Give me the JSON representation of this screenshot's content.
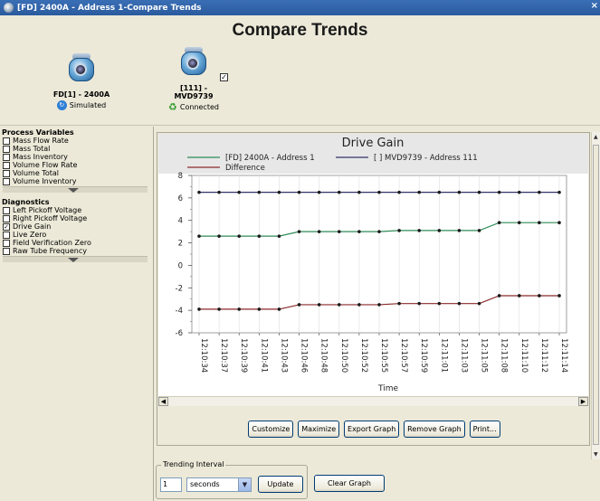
{
  "window": {
    "title": "[FD] 2400A - Address 1-Compare Trends",
    "close_glyph": "×"
  },
  "page": {
    "title": "Compare Trends"
  },
  "devices": [
    {
      "name": "FD[1] - 2400A",
      "status": "Simulated"
    },
    {
      "name_line1": "[111] -",
      "name_line2": "MVD9739",
      "status": "Connected",
      "checked": true
    }
  ],
  "sidebar": {
    "process_variables": {
      "title": "Process Variables",
      "items": [
        {
          "label": "Mass Flow Rate",
          "checked": false
        },
        {
          "label": "Mass Total",
          "checked": false
        },
        {
          "label": "Mass Inventory",
          "checked": false
        },
        {
          "label": "Volume Flow Rate",
          "checked": false
        },
        {
          "label": "Volume Total",
          "checked": false
        },
        {
          "label": "Volume Inventory",
          "checked": false
        }
      ]
    },
    "diagnostics": {
      "title": "Diagnostics",
      "items": [
        {
          "label": "Left Pickoff Voltage",
          "checked": false
        },
        {
          "label": "Right Pickoff Voltage",
          "checked": false
        },
        {
          "label": "Drive Gain",
          "checked": true
        },
        {
          "label": "Live Zero",
          "checked": false
        },
        {
          "label": "Field Verification Zero",
          "checked": false
        },
        {
          "label": "Raw Tube Frequency",
          "checked": false
        }
      ]
    }
  },
  "graph": {
    "buttons": [
      "Customize",
      "Maximize",
      "Export Graph",
      "Remove Graph",
      "Print..."
    ]
  },
  "trending": {
    "legend": "Trending Interval",
    "value": "1",
    "unit": "seconds",
    "update_label": "Update",
    "clear_label": "Clear Graph"
  },
  "chart_data": {
    "type": "line",
    "title": "Drive Gain",
    "xlabel": "Time",
    "ylabel": "",
    "ylim": [
      -6,
      8
    ],
    "yticks": [
      -6,
      -4,
      -2,
      0,
      2,
      4,
      6,
      8
    ],
    "legend_position": "top",
    "categories": [
      "12:10:34",
      "12:10:37",
      "12:10:39",
      "12:10:41",
      "12:10:43",
      "12:10:46",
      "12:10:48",
      "12:10:50",
      "12:10:52",
      "12:10:55",
      "12:10:57",
      "12:10:59",
      "12:11:01",
      "12:11:03",
      "12:11:05",
      "12:11:08",
      "12:11:10",
      "12:11:12",
      "12:11:14"
    ],
    "series": [
      {
        "name": "[FD] 2400A - Address 1",
        "color": "#2e8b57",
        "values": [
          2.6,
          2.6,
          2.6,
          2.6,
          2.6,
          3.0,
          3.0,
          3.0,
          3.0,
          3.0,
          3.1,
          3.1,
          3.1,
          3.1,
          3.1,
          3.8,
          3.8,
          3.8,
          3.8
        ]
      },
      {
        "name": "[           ] MVD9739 - Address 111",
        "color": "#33336b",
        "values": [
          6.5,
          6.5,
          6.5,
          6.5,
          6.5,
          6.5,
          6.5,
          6.5,
          6.5,
          6.5,
          6.5,
          6.5,
          6.5,
          6.5,
          6.5,
          6.5,
          6.5,
          6.5,
          6.5
        ]
      },
      {
        "name": "Difference",
        "color": "#8b2a2a",
        "values": [
          -3.9,
          -3.9,
          -3.9,
          -3.9,
          -3.9,
          -3.5,
          -3.5,
          -3.5,
          -3.5,
          -3.5,
          -3.4,
          -3.4,
          -3.4,
          -3.4,
          -3.4,
          -2.7,
          -2.7,
          -2.7,
          -2.7
        ]
      }
    ]
  }
}
